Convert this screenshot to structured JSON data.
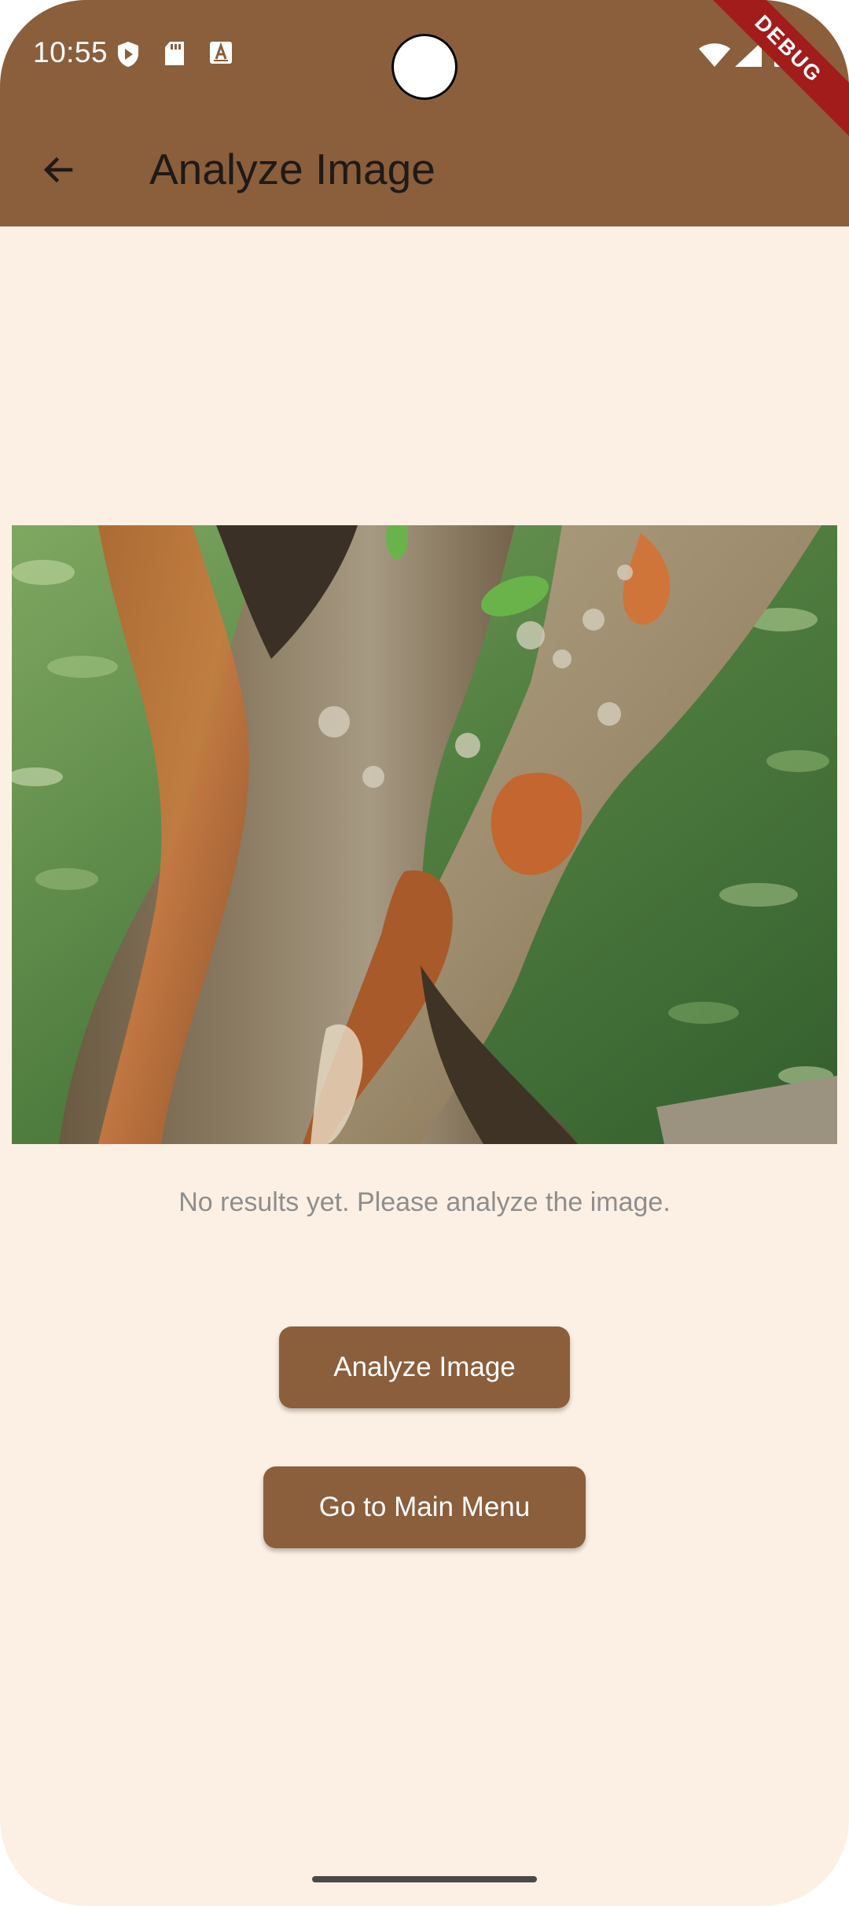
{
  "status_bar": {
    "time": "10:55",
    "icons": [
      "play-protect-icon",
      "sd-card-icon",
      "text-a-icon",
      "wifi-icon",
      "signal-icon",
      "battery-icon"
    ]
  },
  "debug_banner": {
    "label": "DEBUG"
  },
  "app_bar": {
    "title": "Analyze Image",
    "back_icon": "arrow-back-icon",
    "background": "#8b5e3c"
  },
  "main": {
    "image_description_icon": "tree-trunk-photo",
    "result_text": "No results yet. Please analyze the image.",
    "analyze_button": "Analyze Image",
    "main_menu_button": "Go to Main Menu",
    "button_color": "#8b5e3c",
    "background": "#fcf0e4"
  }
}
